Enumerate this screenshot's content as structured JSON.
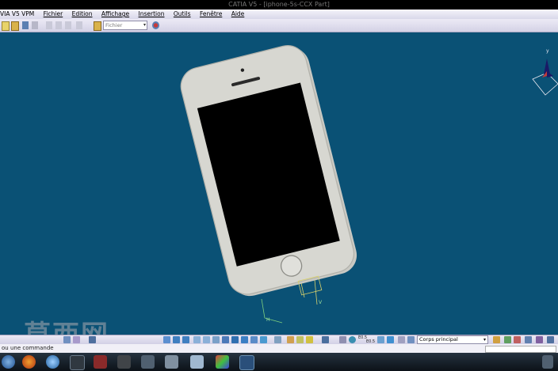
{
  "window": {
    "title": "CATIA V5 - [iphone-5s-CCX Part]"
  },
  "menu": {
    "app": "VIA V5 VPM",
    "items": [
      "Fichier",
      "Edition",
      "Affichage",
      "Insertion",
      "Outils",
      "Fenêtre",
      "Aide"
    ]
  },
  "toolbar": {
    "file_combo": "Fichier"
  },
  "tree": {
    "h_label": "H",
    "v_label": "V"
  },
  "compass": {
    "axis_label": "y"
  },
  "bottom_toolbar": {
    "body_select": "Corps principal",
    "zoom_a": "E0.5",
    "zoom_b": "E0.5"
  },
  "status": {
    "prompt": "ou une commande"
  },
  "watermark": {
    "text": "莫西网"
  },
  "colors": {
    "background": "#0a5175",
    "phone_body": "#d7d7d1",
    "screen": "#000000"
  }
}
